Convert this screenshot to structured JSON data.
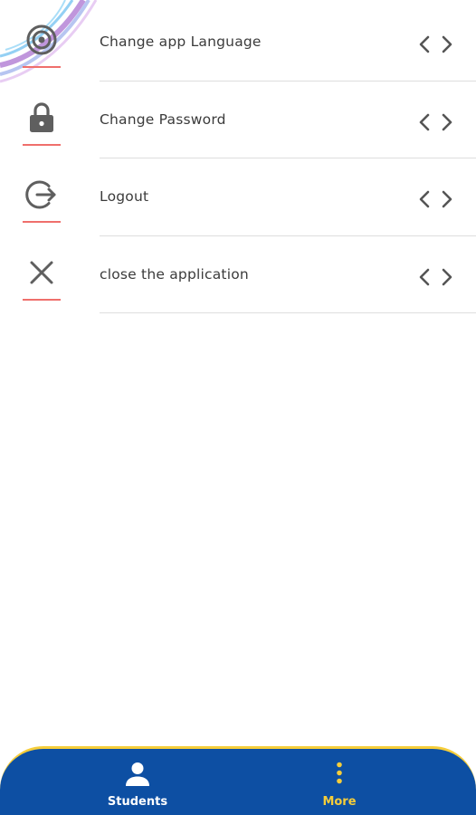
{
  "menu": {
    "items": [
      {
        "label": "Change app Language",
        "icon": "language-icon"
      },
      {
        "label": "Change Password",
        "icon": "lock-icon"
      },
      {
        "label": "Logout",
        "icon": "logout-icon"
      },
      {
        "label": "close the application",
        "icon": "close-icon"
      }
    ],
    "arrow_icon": "chevron-left-right-icon"
  },
  "bottom_nav": {
    "items": [
      {
        "label": "Students",
        "icon": "person-icon",
        "active": false
      },
      {
        "label": "More",
        "icon": "more-vertical-icon",
        "active": true
      }
    ]
  },
  "colors": {
    "nav_background": "#0d4fa3",
    "accent_yellow": "#f5cd3a",
    "icon_underline": "#ef6f6c",
    "icon_gray": "#5f5f5f",
    "text": "#3b3b3b"
  }
}
